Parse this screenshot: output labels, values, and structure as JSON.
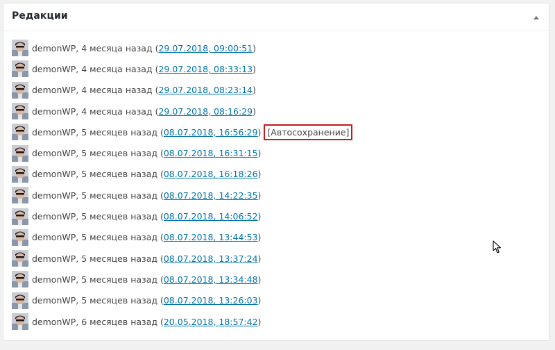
{
  "panel": {
    "title": "Редакции",
    "toggle_icon": "triangle-up-icon"
  },
  "revisions": [
    {
      "author": "demonWP",
      "time": "4 месяца назад",
      "date": "29.07.2018, 09:00:51",
      "autosave": ""
    },
    {
      "author": "demonWP",
      "time": "4 месяца назад",
      "date": "29.07.2018, 08:33:13",
      "autosave": ""
    },
    {
      "author": "demonWP",
      "time": "4 месяца назад",
      "date": "29.07.2018, 08:23:14",
      "autosave": ""
    },
    {
      "author": "demonWP",
      "time": "4 месяца назад",
      "date": "29.07.2018, 08:16:29",
      "autosave": ""
    },
    {
      "author": "demonWP",
      "time": "5 месяцев назад",
      "date": "08.07.2018, 16:56:29",
      "autosave": "[Автосохранение]"
    },
    {
      "author": "demonWP",
      "time": "5 месяцев назад",
      "date": "08.07.2018, 16:31:15",
      "autosave": ""
    },
    {
      "author": "demonWP",
      "time": "5 месяцев назад",
      "date": "08.07.2018, 16:18:26",
      "autosave": ""
    },
    {
      "author": "demonWP",
      "time": "5 месяцев назад",
      "date": "08.07.2018, 14:22:35",
      "autosave": ""
    },
    {
      "author": "demonWP",
      "time": "5 месяцев назад",
      "date": "08.07.2018, 14:06:52",
      "autosave": ""
    },
    {
      "author": "demonWP",
      "time": "5 месяцев назад",
      "date": "08.07.2018, 13:44:53",
      "autosave": ""
    },
    {
      "author": "demonWP",
      "time": "5 месяцев назад",
      "date": "08.07.2018, 13:37:24",
      "autosave": ""
    },
    {
      "author": "demonWP",
      "time": "5 месяцев назад",
      "date": "08.07.2018, 13:34:48",
      "autosave": ""
    },
    {
      "author": "demonWP",
      "time": "5 месяцев назад",
      "date": "08.07.2018, 13:26:03",
      "autosave": ""
    },
    {
      "author": "demonWP",
      "time": "6 месяцев назад",
      "date": "20.05.2018, 18:57:42",
      "autosave": ""
    }
  ],
  "colors": {
    "link": "#0073aa",
    "highlight_border": "#c31a1a",
    "text": "#444444"
  }
}
